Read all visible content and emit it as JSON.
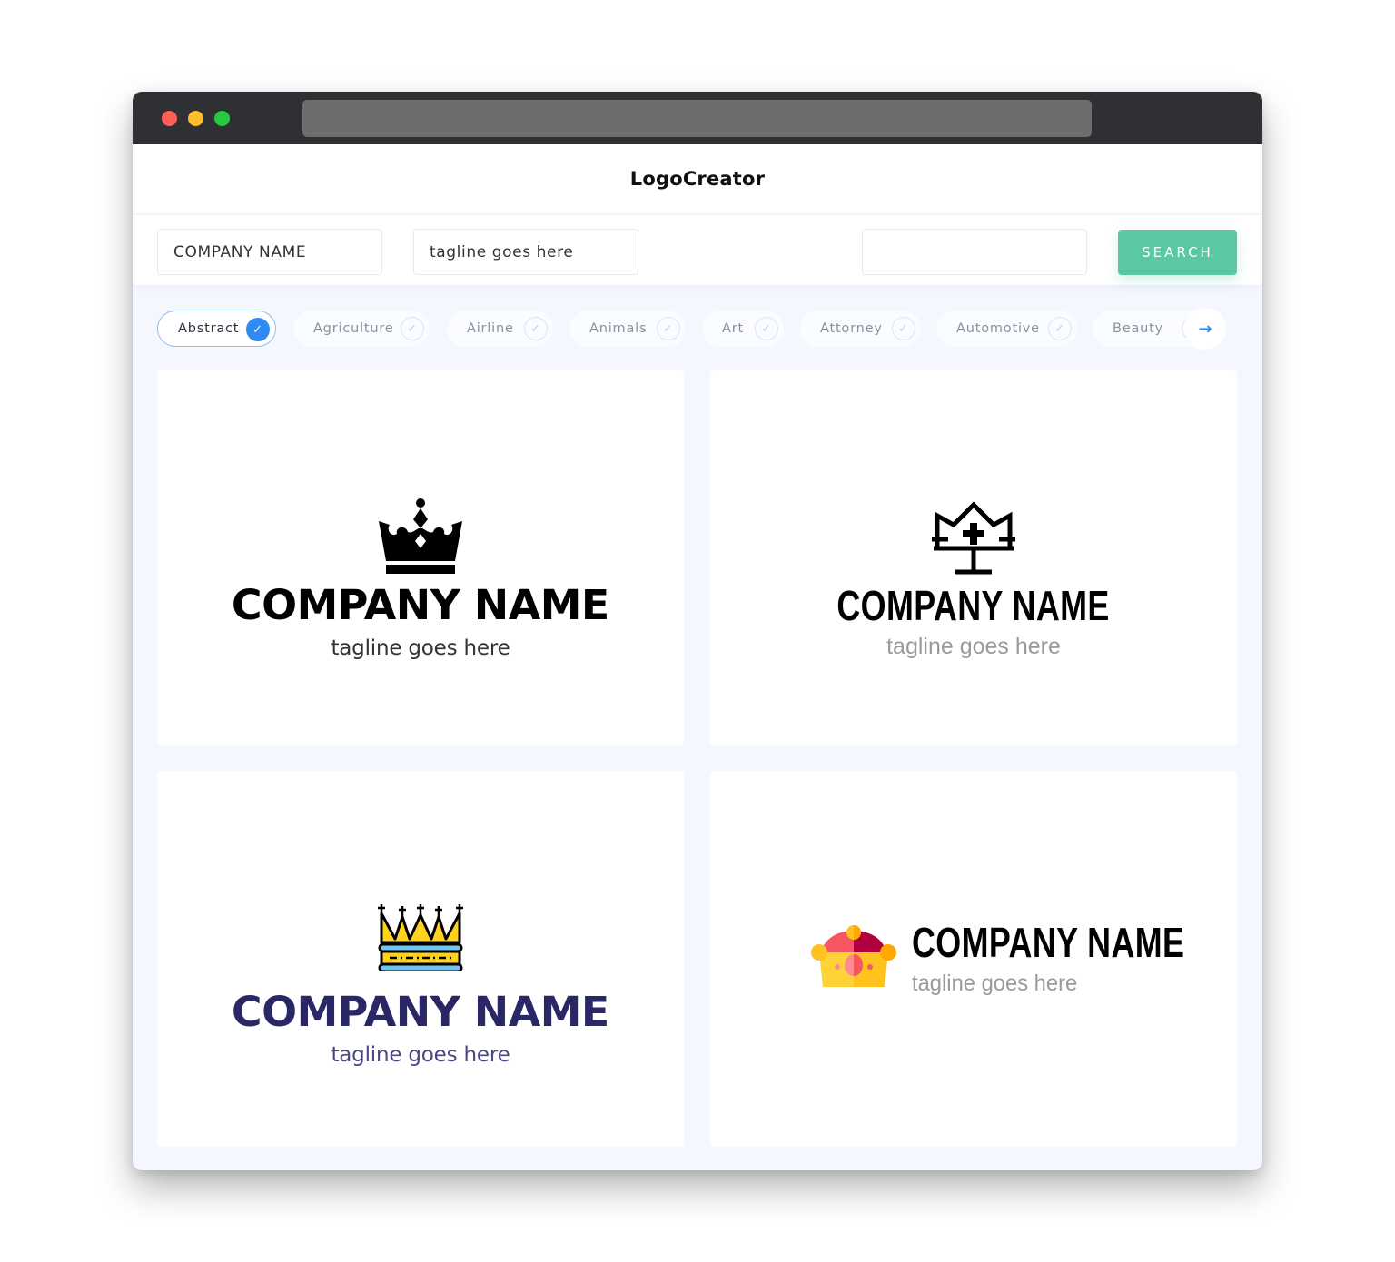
{
  "window": {
    "controls": [
      "close",
      "minimize",
      "maximize"
    ],
    "url": ""
  },
  "header": {
    "brand": "LogoCreator"
  },
  "search": {
    "company_value": "COMPANY NAME",
    "tagline_value": "tagline goes here",
    "keyword_value": "",
    "button_label": "SEARCH"
  },
  "categories": {
    "items": [
      {
        "label": "Abstract",
        "selected": true
      },
      {
        "label": "Agriculture",
        "selected": false
      },
      {
        "label": "Airline",
        "selected": false
      },
      {
        "label": "Animals",
        "selected": false
      },
      {
        "label": "Art",
        "selected": false
      },
      {
        "label": "Attorney",
        "selected": false
      },
      {
        "label": "Automotive",
        "selected": false
      },
      {
        "label": "Beauty",
        "selected": false
      }
    ],
    "next_icon": "arrow-right-icon"
  },
  "cards": [
    {
      "icon": "crown-solid-icon",
      "name": "COMPANY NAME",
      "tagline": "tagline goes here",
      "name_color": "#000000",
      "tagline_color": "#333333"
    },
    {
      "icon": "crown-outline-cross-icon",
      "name": "COMPANY NAME",
      "tagline": "tagline goes here",
      "name_color": "#000000",
      "tagline_color": "#9a9a9a"
    },
    {
      "icon": "crown-yellow-icon",
      "name": "COMPANY NAME",
      "tagline": "tagline goes here",
      "name_color": "#2a2766",
      "tagline_color": "#4a4880"
    },
    {
      "icon": "crown-flat-color-icon",
      "name": "COMPANY NAME",
      "tagline": "tagline goes here",
      "name_color": "#000000",
      "tagline_color": "#9a9a9a"
    }
  ],
  "colors": {
    "accent": "#5ac8a0",
    "chip_selected": "#2f8bf0",
    "titlebar": "#2f3033",
    "background": "#f4f7fd"
  }
}
